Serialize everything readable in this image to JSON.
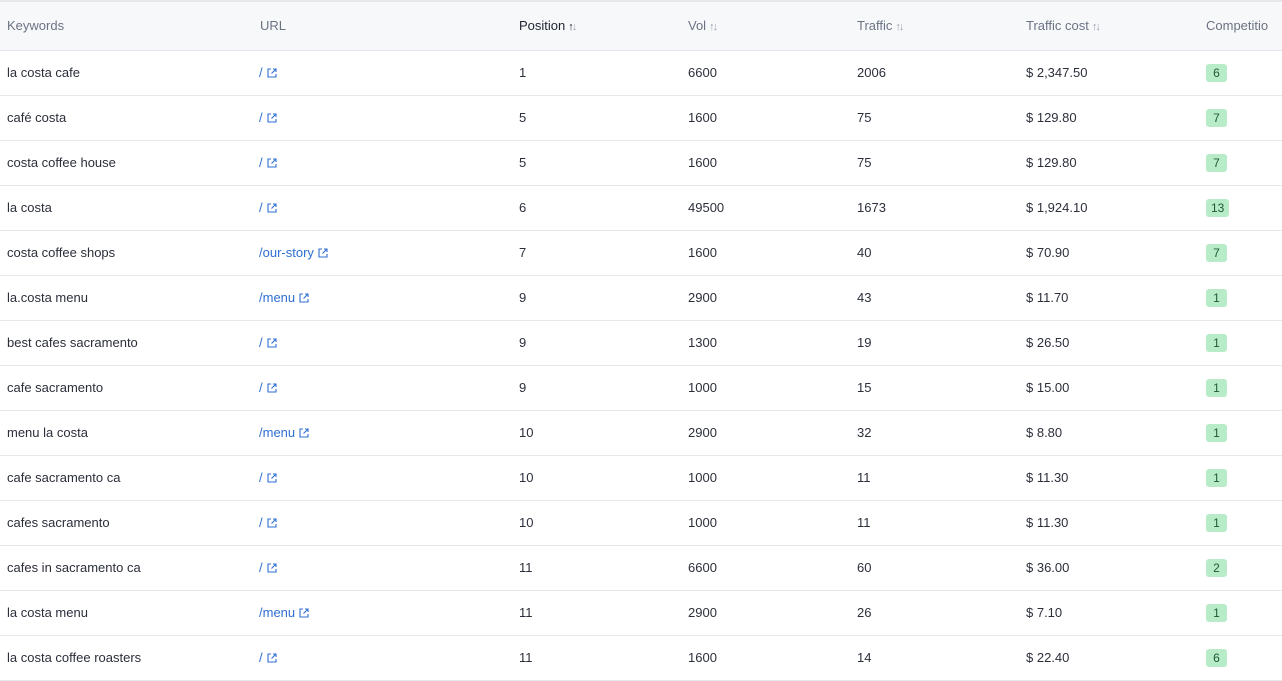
{
  "colors": {
    "link": "#2f6fd1",
    "badge_bg": "#b8ecc9",
    "header_bg": "#f7f8fa"
  },
  "table": {
    "headers": {
      "keywords": "Keywords",
      "url": "URL",
      "position": "Position",
      "vol": "Vol",
      "traffic": "Traffic",
      "traffic_cost": "Traffic cost",
      "competition": "Competitio"
    },
    "sort": {
      "active_column": "position",
      "direction": "ascending"
    },
    "rows": [
      {
        "keyword": "la costa cafe",
        "url": "/",
        "position": "1",
        "vol": "6600",
        "traffic": "2006",
        "cost": "$ 2,347.50",
        "competition": "6"
      },
      {
        "keyword": "café costa",
        "url": "/",
        "position": "5",
        "vol": "1600",
        "traffic": "75",
        "cost": "$ 129.80",
        "competition": "7"
      },
      {
        "keyword": "costa coffee house",
        "url": "/",
        "position": "5",
        "vol": "1600",
        "traffic": "75",
        "cost": "$ 129.80",
        "competition": "7"
      },
      {
        "keyword": "la costa",
        "url": "/",
        "position": "6",
        "vol": "49500",
        "traffic": "1673",
        "cost": "$ 1,924.10",
        "competition": "13"
      },
      {
        "keyword": "costa coffee shops",
        "url": "/our-story",
        "position": "7",
        "vol": "1600",
        "traffic": "40",
        "cost": "$ 70.90",
        "competition": "7"
      },
      {
        "keyword": "la.costa menu",
        "url": "/menu",
        "position": "9",
        "vol": "2900",
        "traffic": "43",
        "cost": "$ 11.70",
        "competition": "1"
      },
      {
        "keyword": "best cafes sacramento",
        "url": "/",
        "position": "9",
        "vol": "1300",
        "traffic": "19",
        "cost": "$ 26.50",
        "competition": "1"
      },
      {
        "keyword": "cafe sacramento",
        "url": "/",
        "position": "9",
        "vol": "1000",
        "traffic": "15",
        "cost": "$ 15.00",
        "competition": "1"
      },
      {
        "keyword": "menu la costa",
        "url": "/menu",
        "position": "10",
        "vol": "2900",
        "traffic": "32",
        "cost": "$ 8.80",
        "competition": "1"
      },
      {
        "keyword": "cafe sacramento ca",
        "url": "/",
        "position": "10",
        "vol": "1000",
        "traffic": "11",
        "cost": "$ 11.30",
        "competition": "1"
      },
      {
        "keyword": "cafes sacramento",
        "url": "/",
        "position": "10",
        "vol": "1000",
        "traffic": "11",
        "cost": "$ 11.30",
        "competition": "1"
      },
      {
        "keyword": "cafes in sacramento ca",
        "url": "/",
        "position": "11",
        "vol": "6600",
        "traffic": "60",
        "cost": "$ 36.00",
        "competition": "2"
      },
      {
        "keyword": "la costa menu",
        "url": "/menu",
        "position": "11",
        "vol": "2900",
        "traffic": "26",
        "cost": "$ 7.10",
        "competition": "1"
      },
      {
        "keyword": "la costa coffee roasters",
        "url": "/",
        "position": "11",
        "vol": "1600",
        "traffic": "14",
        "cost": "$ 22.40",
        "competition": "6"
      }
    ]
  }
}
